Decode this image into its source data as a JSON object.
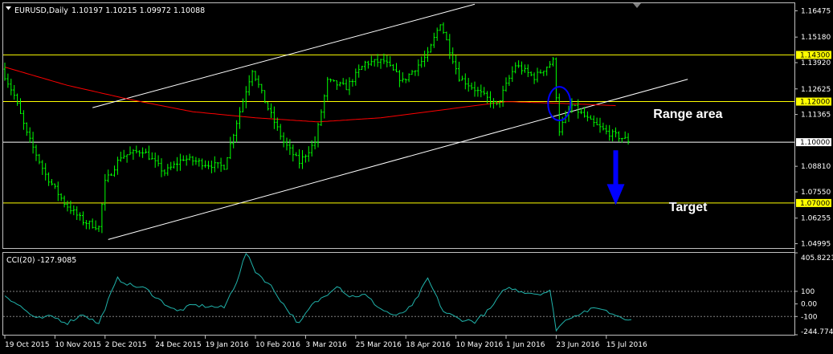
{
  "chart_data": [
    {
      "type": "ohlc",
      "title": "EURUSD,Daily",
      "ohlc": "1.10197 1.10215 1.09972 1.10088",
      "ylim": [
        1.0478,
        1.1685
      ],
      "y_ticks": [
        1.16475,
        1.1518,
        1.1392,
        1.12625,
        1.11365,
        1.0881,
        1.0755,
        1.06255,
        1.04995
      ],
      "x_ticks": [
        "19 Oct 2015",
        "10 Nov 2015",
        "2 Dec 2015",
        "24 Dec 2015",
        "19 Jan 2016",
        "10 Feb 2016",
        "3 Mar 2016",
        "25 Mar 2016",
        "18 Apr 2016",
        "10 May 2016",
        "1 Jun 2016",
        "23 Jun 2016",
        "15 Jul 2016"
      ],
      "x_tick_index": [
        0,
        16,
        32,
        48,
        64,
        80,
        96,
        112,
        128,
        144,
        160,
        176,
        192
      ],
      "n_bars": 200,
      "close_path": [
        [
          0,
          1.136
        ],
        [
          4,
          1.123
        ],
        [
          8,
          1.104
        ],
        [
          14,
          1.084
        ],
        [
          20,
          1.07
        ],
        [
          26,
          1.061
        ],
        [
          31,
          1.058
        ],
        [
          33,
          1.08
        ],
        [
          38,
          1.093
        ],
        [
          45,
          1.096
        ],
        [
          52,
          1.085
        ],
        [
          58,
          1.092
        ],
        [
          66,
          1.089
        ],
        [
          71,
          1.088
        ],
        [
          75,
          1.11
        ],
        [
          80,
          1.136
        ],
        [
          84,
          1.12
        ],
        [
          90,
          1.1
        ],
        [
          95,
          1.09
        ],
        [
          100,
          1.1
        ],
        [
          104,
          1.13
        ],
        [
          110,
          1.127
        ],
        [
          116,
          1.139
        ],
        [
          122,
          1.14
        ],
        [
          128,
          1.13
        ],
        [
          136,
          1.143
        ],
        [
          140,
          1.159
        ],
        [
          146,
          1.132
        ],
        [
          152,
          1.125
        ],
        [
          158,
          1.118
        ],
        [
          164,
          1.138
        ],
        [
          170,
          1.132
        ],
        [
          176,
          1.14
        ],
        [
          178,
          1.106
        ],
        [
          182,
          1.118
        ],
        [
          188,
          1.11
        ],
        [
          193,
          1.105
        ],
        [
          200,
          1.1009
        ]
      ],
      "horizontal_levels": [
        {
          "value": 1.143,
          "label": "1.14300",
          "color": "#ffff00"
        },
        {
          "value": 1.12,
          "label": "1.12000",
          "color": "#ffff00"
        },
        {
          "value": 1.1,
          "label": "1.10000",
          "color": "#ffffff"
        },
        {
          "value": 1.07,
          "label": "1.07000",
          "color": "#ffff00"
        }
      ],
      "trendlines": [
        {
          "from": [
            28,
            1.117
          ],
          "to": [
            150,
            1.168
          ],
          "color": "#ffffff"
        },
        {
          "from": [
            33,
            1.052
          ],
          "to": [
            218,
            1.131
          ],
          "color": "#ffffff"
        }
      ],
      "moving_average": {
        "color": "#ff0000",
        "points": [
          [
            0,
            1.137
          ],
          [
            20,
            1.128
          ],
          [
            40,
            1.121
          ],
          [
            60,
            1.115
          ],
          [
            80,
            1.112
          ],
          [
            100,
            1.11
          ],
          [
            120,
            1.112
          ],
          [
            140,
            1.116
          ],
          [
            160,
            1.12
          ],
          [
            180,
            1.119
          ],
          [
            195,
            1.118
          ]
        ]
      },
      "annotations": [
        {
          "text": "Range area",
          "at": [
            207,
            1.112
          ]
        },
        {
          "text": "Target",
          "at": [
            212,
            1.066
          ]
        }
      ],
      "ellipse": {
        "center": [
          177,
          1.119
        ],
        "color": "#0000ff"
      },
      "arrow": {
        "from": [
          195,
          1.096
        ],
        "to": [
          195,
          1.069
        ],
        "color": "#0000ff"
      },
      "colors": {
        "bars": "#00ff00",
        "background": "#000000",
        "level": "#ffff00",
        "trend": "#ffffff",
        "ma": "#ff0000",
        "marker": "#0000ff"
      }
    },
    {
      "type": "line",
      "title": "CCI(20) -127.9085",
      "ylim": [
        -244.7742,
        405.8221
      ],
      "y_ticks": [
        "405.8221",
        "100",
        "0.00",
        "-100",
        "-244.7742"
      ],
      "y_tick_values": [
        405.8221,
        100,
        0,
        -100,
        -244.7742
      ],
      "levels": [
        100,
        -100
      ],
      "series": [
        {
          "color": "#20b2aa",
          "points": [
            [
              0,
              70
            ],
            [
              5,
              -20
            ],
            [
              10,
              -120
            ],
            [
              15,
              -100
            ],
            [
              20,
              -150
            ],
            [
              25,
              -80
            ],
            [
              30,
              -160
            ],
            [
              33,
              30
            ],
            [
              36,
              200
            ],
            [
              40,
              150
            ],
            [
              45,
              120
            ],
            [
              50,
              20
            ],
            [
              55,
              -60
            ],
            [
              60,
              -10
            ],
            [
              65,
              -20
            ],
            [
              70,
              -30
            ],
            [
              74,
              180
            ],
            [
              77,
              405
            ],
            [
              80,
              260
            ],
            [
              85,
              140
            ],
            [
              90,
              -40
            ],
            [
              94,
              -160
            ],
            [
              98,
              -10
            ],
            [
              102,
              60
            ],
            [
              106,
              150
            ],
            [
              110,
              60
            ],
            [
              115,
              70
            ],
            [
              120,
              -40
            ],
            [
              125,
              -100
            ],
            [
              130,
              -20
            ],
            [
              135,
              200
            ],
            [
              140,
              -60
            ],
            [
              145,
              -120
            ],
            [
              150,
              -140
            ],
            [
              155,
              -40
            ],
            [
              160,
              130
            ],
            [
              165,
              100
            ],
            [
              170,
              80
            ],
            [
              174,
              100
            ],
            [
              176,
              -200
            ],
            [
              180,
              -110
            ],
            [
              185,
              -60
            ],
            [
              190,
              -30
            ],
            [
              193,
              -70
            ],
            [
              200,
              -128
            ]
          ]
        }
      ]
    }
  ]
}
